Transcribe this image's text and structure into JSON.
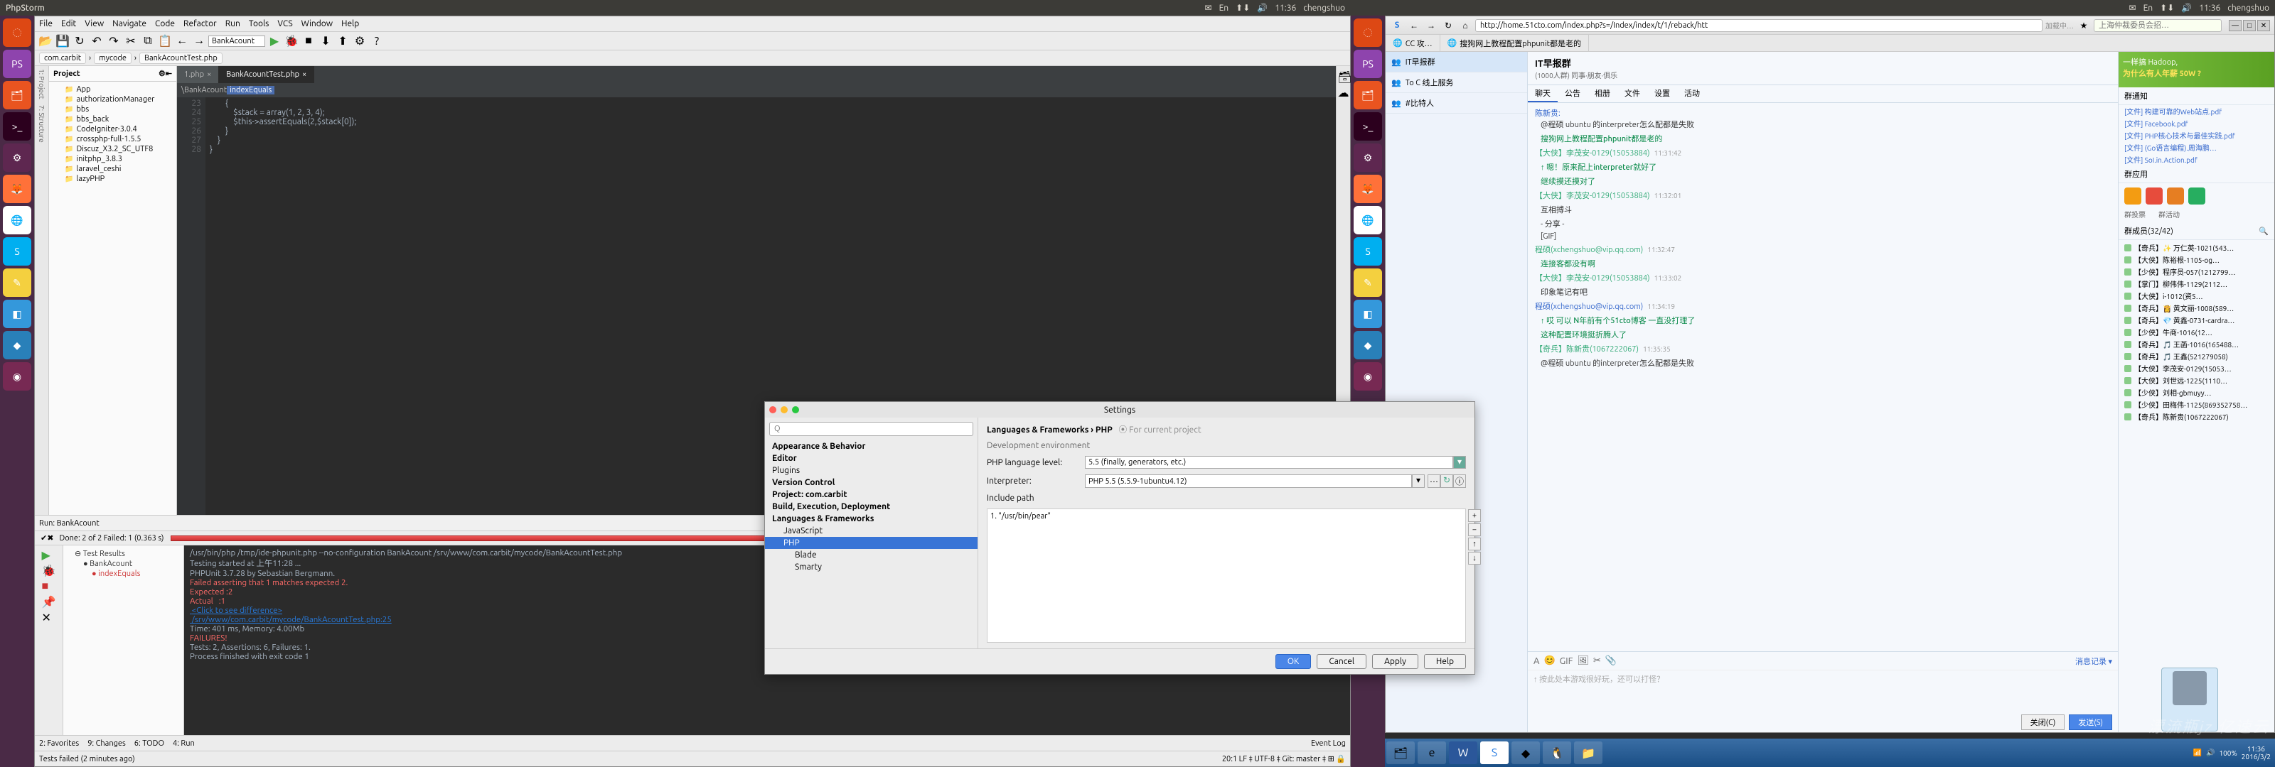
{
  "left": {
    "sysbar": {
      "title": "PhpStorm",
      "time": "11:36",
      "user": "chengshuo",
      "lang": "En"
    },
    "launcher": [
      {
        "name": "dash",
        "bg": "#dd4814",
        "glyph": "◌"
      },
      {
        "name": "phpstorm",
        "bg": "#8e44ad",
        "glyph": "PS"
      },
      {
        "name": "files",
        "bg": "#e95420",
        "glyph": "🗂"
      },
      {
        "name": "terminal",
        "bg": "#2c001e",
        "glyph": ">_"
      },
      {
        "name": "settings",
        "bg": "#5e2750",
        "glyph": "⚙"
      },
      {
        "name": "firefox",
        "bg": "#ff7139",
        "glyph": "🦊"
      },
      {
        "name": "chrome",
        "bg": "#fff",
        "glyph": "🌐"
      },
      {
        "name": "skype",
        "bg": "#00aff0",
        "glyph": "S"
      },
      {
        "name": "editor",
        "bg": "#f4d03f",
        "glyph": "✎"
      },
      {
        "name": "app1",
        "bg": "#3498db",
        "glyph": "◧"
      },
      {
        "name": "app2",
        "bg": "#2980b9",
        "glyph": "◆"
      },
      {
        "name": "ubuntu",
        "bg": "#772953",
        "glyph": "◉"
      }
    ],
    "menu": [
      "File",
      "Edit",
      "View",
      "Navigate",
      "Code",
      "Refactor",
      "Run",
      "Tools",
      "VCS",
      "Window",
      "Help"
    ],
    "runconfig": "BankAcount",
    "crumbs": [
      "com.carbit",
      "mycode",
      "BankAcountTest.php"
    ],
    "project_header": "Project",
    "project_tree": [
      "App",
      "authorizationManager",
      "bbs",
      "bbs_back",
      "CodeIgniter-3.0.4",
      "crossphp-full-1.5.5",
      "Discuz_X3.2_SC_UTF8",
      "initphp_3.8.3",
      "laravel_ceshi",
      "lazyPHP"
    ],
    "tabs": [
      {
        "label": "1.php",
        "active": false
      },
      {
        "label": "BankAcountTest.php",
        "active": true
      }
    ],
    "editor_crumb": {
      "path": "\\BankAcount",
      "hl": "indexEquals"
    },
    "code_start": 23,
    "code_lines": [
      "        {",
      "            $stack = array(1, 2, 3, 4);",
      "            $this->assertEquals(2,$stack[0]);",
      "        }",
      "    }",
      "}"
    ],
    "run": {
      "header": "Run:",
      "config": "BankAcount",
      "stats": "Done: 2 of 2  Failed: 1 (0.363 s)",
      "tree": [
        "Test Results",
        "BankAcount",
        "indexEquals"
      ],
      "out": [
        {
          "cls": "ok",
          "t": "/usr/bin/php /tmp/ide-phpunit.php --no-configuration BankAcount /srv/www/com.carbit/mycode/BankAcountTest.php"
        },
        {
          "cls": "ok",
          "t": "Testing started at 上午11:28 ..."
        },
        {
          "cls": "ok",
          "t": "PHPUnit 3.7.28 by Sebastian Bergmann."
        },
        {
          "cls": "ok",
          "t": ""
        },
        {
          "cls": "err",
          "t": "Failed asserting that 1 matches expected 2."
        },
        {
          "cls": "err",
          "t": "Expected :2"
        },
        {
          "cls": "err",
          "t": "Actual   :1"
        },
        {
          "cls": "link",
          "t": " <Click to see difference>"
        },
        {
          "cls": "ok",
          "t": ""
        },
        {
          "cls": "link",
          "t": " /srv/www/com.carbit/mycode/BankAcountTest.php:25"
        },
        {
          "cls": "ok",
          "t": ""
        },
        {
          "cls": "ok",
          "t": ""
        },
        {
          "cls": "ok",
          "t": "Time: 401 ms, Memory: 4.00Mb"
        },
        {
          "cls": "ok",
          "t": ""
        },
        {
          "cls": "err",
          "t": "FAILURES!"
        },
        {
          "cls": "ok",
          "t": "Tests: 2, Assertions: 6, Failures: 1."
        },
        {
          "cls": "ok",
          "t": ""
        },
        {
          "cls": "ok",
          "t": "Process finished with exit code 1"
        }
      ]
    },
    "bottom_tabs": [
      "9: Changes",
      "6: TODO",
      "4: Run"
    ],
    "event_log": "Event Log",
    "status_left": "Tests failed (2 minutes ago)",
    "status_right": "20:1   LF ‡   UTF-8 ‡   Git: master ‡   ⊞   🔒",
    "left_tool_tabs": [
      "1: Project",
      "7: Structure"
    ],
    "fav_tab": "2: Favorites"
  },
  "settings": {
    "title": "Settings",
    "search_ph": "Q",
    "categories": [
      {
        "label": "Appearance & Behavior",
        "cls": "b"
      },
      {
        "label": "Editor",
        "cls": "b"
      },
      {
        "label": "Plugins",
        "cls": ""
      },
      {
        "label": "Version Control",
        "cls": "b"
      },
      {
        "label": "Project: com.carbit",
        "cls": "b"
      },
      {
        "label": "Build, Execution, Deployment",
        "cls": "b"
      },
      {
        "label": "Languages & Frameworks",
        "cls": "b"
      },
      {
        "label": "JavaScript",
        "cls": "sub"
      },
      {
        "label": "PHP",
        "cls": "sub sel"
      },
      {
        "label": "Blade",
        "cls": "sub2"
      },
      {
        "label": "Smarty",
        "cls": "sub2"
      }
    ],
    "heading": "Languages & Frameworks › PHP",
    "scope": "For current project",
    "dev_env": "Development environment",
    "lang_level_label": "PHP language level:",
    "lang_level": "5.5",
    "lang_level_hint": "(finally, generators, etc.)",
    "interpreter_label": "Interpreter:",
    "interpreter": "PHP 5.5 (5.5.9-1ubuntu4.12)",
    "include_label": "Include path",
    "include_item": "1. \"/usr/bin/pear\"",
    "buttons": {
      "ok": "OK",
      "cancel": "Cancel",
      "apply": "Apply",
      "help": "Help"
    }
  },
  "right": {
    "sysbar": {
      "time": "11:36",
      "user": "chengshuo",
      "lang": "En"
    },
    "launcher": [
      {
        "name": "dash",
        "bg": "#dd4814",
        "glyph": "◌"
      },
      {
        "name": "phpstorm",
        "bg": "#8e44ad",
        "glyph": "PS"
      },
      {
        "name": "files",
        "bg": "#e95420",
        "glyph": "🗂"
      },
      {
        "name": "terminal",
        "bg": "#2c001e",
        "glyph": ">_"
      },
      {
        "name": "settings",
        "bg": "#5e2750",
        "glyph": "⚙"
      },
      {
        "name": "firefox",
        "bg": "#ff7139",
        "glyph": "🦊"
      },
      {
        "name": "chrome",
        "bg": "#fff",
        "glyph": "🌐"
      },
      {
        "name": "skype",
        "bg": "#00aff0",
        "glyph": "S"
      },
      {
        "name": "editor",
        "bg": "#f4d03f",
        "glyph": "✎"
      },
      {
        "name": "app1",
        "bg": "#3498db",
        "glyph": "◧"
      },
      {
        "name": "app2",
        "bg": "#2980b9",
        "glyph": "◆"
      },
      {
        "name": "ubuntu",
        "bg": "#772953",
        "glyph": "◉"
      }
    ],
    "browser": {
      "url": "http://home.51cto.com/index.php?s=/Index/index/t/1/reback/htt",
      "url_label": "加载中…",
      "search_ph": "上海仲裁委员会招…",
      "tabs": [
        "CC 攻…",
        "搜狗网上教程配置phpunit都是老的"
      ]
    },
    "chat": {
      "left_items": [
        "IT早报群",
        "To C 线上服务",
        "#比特人"
      ],
      "title": "IT早报群",
      "subtitle": "(1000人群)  同事·朋友·俱乐",
      "nav": [
        "聊天",
        "公告",
        "相册",
        "文件",
        "设置",
        "活动"
      ],
      "messages": [
        {
          "u": "陈新贵:",
          "uc": "blue",
          "t": "",
          "c": "@程硕 ubuntu 的interpreter怎么配都是失败",
          "cc": ""
        },
        {
          "u": "",
          "uc": "",
          "t": "",
          "c": "搜狗网上教程配置phpunit都是老的",
          "cc": "green"
        },
        {
          "u": "【大侠】李茂安-0129(15053884)",
          "uc": "",
          "t": "11:31:42",
          "c": "",
          "cc": ""
        },
        {
          "u": "",
          "uc": "",
          "t": "",
          "c": "↑ 嗯！原来配上interpreter就好了",
          "cc": "green"
        },
        {
          "u": "",
          "uc": "",
          "t": "",
          "c": "继续摸还摸对了",
          "cc": "green"
        },
        {
          "u": "【大侠】李茂安-0129(15053884)",
          "uc": "",
          "t": "11:32:01",
          "c": "",
          "cc": ""
        },
        {
          "u": "",
          "uc": "",
          "t": "",
          "c": "互相搏斗",
          "cc": ""
        },
        {
          "u": "",
          "uc": "",
          "t": "",
          "c": "- 分享 -",
          "cc": ""
        },
        {
          "u": "",
          "uc": "",
          "t": "",
          "c": "[GIF]",
          "cc": ""
        },
        {
          "u": "程硕(xchengshuo@vip.qq.com)",
          "uc": "",
          "t": "11:32:47",
          "c": "",
          "cc": ""
        },
        {
          "u": "",
          "uc": "",
          "t": "",
          "c": "连接客都没有啊",
          "cc": "green"
        },
        {
          "u": "【大侠】李茂安-0129(15053884)",
          "uc": "",
          "t": "11:33:02",
          "c": "",
          "cc": ""
        },
        {
          "u": "",
          "uc": "",
          "t": "",
          "c": "印象笔记有吧",
          "cc": ""
        },
        {
          "u": "程硕(xchengshuo@vip.qq.com)",
          "uc": "blue",
          "t": "11:34:19",
          "c": "",
          "cc": ""
        },
        {
          "u": "",
          "uc": "",
          "t": "",
          "c": "↑ 哎 可以 N年前有个51cto博客 一直没打理了",
          "cc": "green"
        },
        {
          "u": "",
          "uc": "",
          "t": "",
          "c": "这种配置环境挺折腾人了",
          "cc": "green"
        },
        {
          "u": "【奇兵】陈新贵(1067222067)",
          "uc": "",
          "t": "11:35:35",
          "c": "",
          "cc": ""
        },
        {
          "u": "",
          "uc": "",
          "t": "",
          "c": "@程硕 ubuntu 的interpreter怎么配都是失败",
          "cc": ""
        }
      ],
      "input_ph": "↑ 按此处本游戏很好玩，还可以打怪？",
      "history": "消息记录 ▾",
      "close_btn": "关闭(C)",
      "send_btn": "发送(S)",
      "ad": {
        "l1": "一样搞 Hadoop,",
        "l2": "为什么有人年薪 50W ?"
      },
      "notice_hdr": "群通知",
      "files": [
        "[文件] 构建可靠的Web站点.pdf",
        "[文件] Facebook.pdf",
        "[文件] PHP核心技术与最佳实践.pdf",
        "[文件] (Go语言编程).周海鹏…",
        "[文件] SoI.in.Action.pdf"
      ],
      "app_hdr": "群应用",
      "apps": [
        {
          "name": "app-1",
          "bg": "#f39c12"
        },
        {
          "name": "app-2",
          "bg": "#e74c3c"
        },
        {
          "name": "app-3",
          "bg": "#e67e22"
        },
        {
          "name": "app-4",
          "bg": "#27ae60"
        }
      ],
      "app_labels": [
        "群投票",
        "群活动"
      ],
      "members_hdr": "群成员(32/42)",
      "members": [
        "【奇兵】✨ 万仁英-1021(543…",
        "【大侠】陈裕根-1105-og…",
        "【少侠】程序员-057(1212799…",
        "【掌门】柳伟伟-1129(2112…",
        "【大侠】i-1012(资5…",
        "【奇兵】👸 黄文丽-1008(589…",
        "【奇兵】💎 黄鑫-0731-cardra…",
        "【少侠】牛商-1016(12…",
        "【奇兵】🎵 王菡-1016(165488…",
        "【奇兵】🎵 王鑫(521279058)",
        "【大侠】李茂安-0129(15053…",
        "【大侠】刘世远-1225(1110…",
        "【少侠】刘相-gbmuyy…",
        "【少侠】田梅伟-1125(869352758…",
        "【奇兵】陈新贵(1067222067)"
      ]
    },
    "taskbar": {
      "time": "11:36",
      "date": "2016/3/2",
      "volume": "100%"
    },
    "watermark": "漂流瓶jz  亿速云"
  }
}
